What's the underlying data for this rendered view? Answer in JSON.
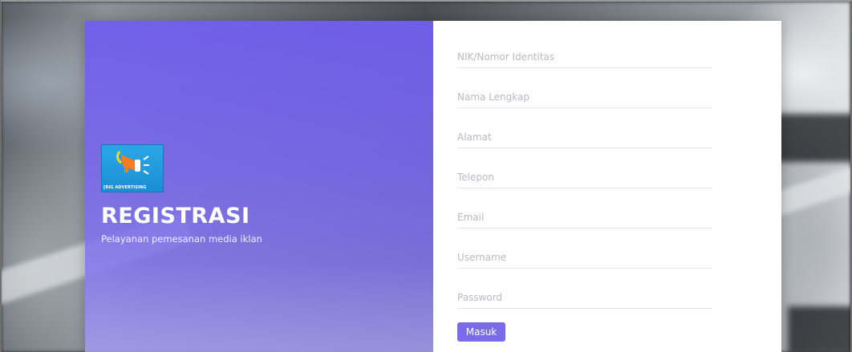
{
  "brand": {
    "logo_text": "[RIG ADVERTISING",
    "logo_icon": "megaphone-icon"
  },
  "hero": {
    "title": "REGISTRASI",
    "subtitle": "Pelayanan pemesanan media iklan"
  },
  "form": {
    "fields": [
      {
        "name": "nik",
        "placeholder": "NIK/Nomor Identitas",
        "value": ""
      },
      {
        "name": "nama",
        "placeholder": "Nama Lengkap",
        "value": ""
      },
      {
        "name": "alamat",
        "placeholder": "Alamat",
        "value": ""
      },
      {
        "name": "telepon",
        "placeholder": "Telepon",
        "value": ""
      },
      {
        "name": "email",
        "placeholder": "Email",
        "value": ""
      },
      {
        "name": "username",
        "placeholder": "Username",
        "value": ""
      },
      {
        "name": "password",
        "placeholder": "Password",
        "value": ""
      }
    ],
    "submit_label": "Masuk"
  },
  "colors": {
    "accent": "#7a6bea",
    "panel_gradient_top": "#705eec",
    "logo_bg": "#2aa7e6",
    "field_border": "#e6e6ec"
  }
}
